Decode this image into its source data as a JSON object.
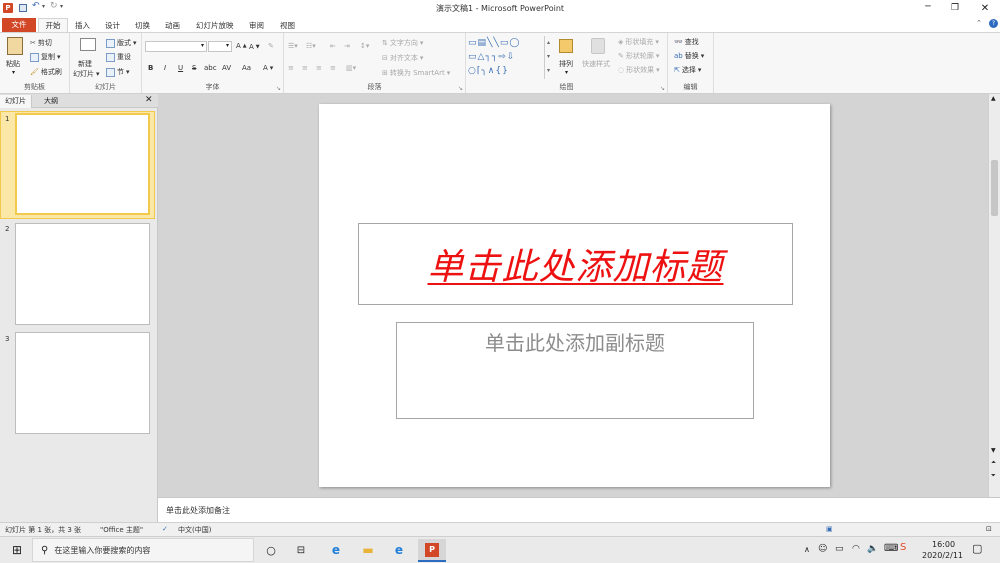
{
  "app": {
    "window_title": "演示文稿1 - Microsoft PowerPoint"
  },
  "tabs": [
    {
      "label": "文件"
    },
    {
      "label": "开始"
    },
    {
      "label": "插入"
    },
    {
      "label": "设计"
    },
    {
      "label": "切换"
    },
    {
      "label": "动画"
    },
    {
      "label": "幻灯片放映"
    },
    {
      "label": "审阅"
    },
    {
      "label": "视图"
    }
  ],
  "ribbon": {
    "clipboard": {
      "paste": "粘贴",
      "cut": "剪切",
      "copy": "复制",
      "format_painter": "格式刷",
      "group": "剪贴板"
    },
    "slides": {
      "new_slide_1": "新建",
      "new_slide_2": "幻灯片",
      "layout": "版式",
      "reset": "重设",
      "section": "节",
      "group": "幻灯片"
    },
    "font": {
      "group": "字体",
      "bold": "B",
      "italic": "I",
      "underline": "U",
      "strike": "S",
      "shadow": "abc",
      "spacing": "AV",
      "case": "Aa",
      "color": "A"
    },
    "paragraph": {
      "text_direction": "文字方向",
      "align_text": "对齐文本",
      "smartart": "转换为 SmartArt",
      "group": "段落"
    },
    "drawing": {
      "arrange": "排列",
      "quick_styles": "快速样式",
      "shape_fill": "形状填充",
      "shape_outline": "形状轮廓",
      "shape_effects": "形状效果",
      "group": "绘图"
    },
    "editing": {
      "find": "查找",
      "replace": "替换",
      "select": "选择",
      "group": "编辑"
    }
  },
  "left_pane": {
    "tabs": [
      "幻灯片",
      "大纲"
    ],
    "slides": [
      "1",
      "2",
      "3"
    ]
  },
  "slide": {
    "title_placeholder": "单击此处添加标题",
    "subtitle_placeholder": "单击此处添加副标题"
  },
  "notes": {
    "placeholder": "单击此处添加备注"
  },
  "status": {
    "slide_info": "幻灯片 第 1 张，共 3 张",
    "theme": "\"Office 主题\"",
    "language": "中文(中国)"
  },
  "taskbar": {
    "search_placeholder": "在这里输入你要搜索的内容",
    "time": "16:00",
    "date": "2020/2/11"
  },
  "colors": {
    "file_tab": "#d24726",
    "title_text": "#ee1111",
    "subtitle_text": "#8c8c8c",
    "selected_thumb": "#f2c94c"
  }
}
